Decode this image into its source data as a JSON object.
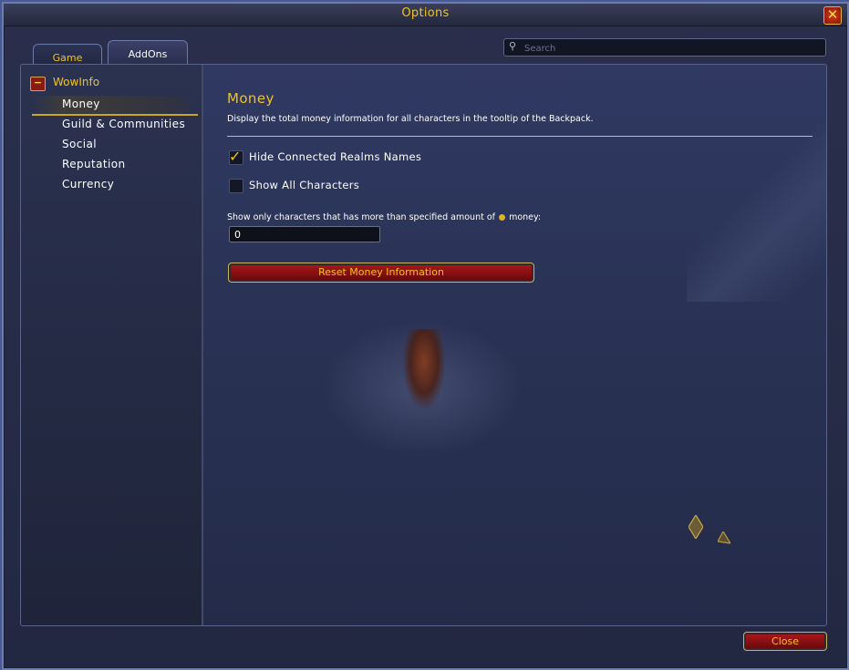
{
  "window": {
    "title": "Options",
    "close_glyph": "✕"
  },
  "tabs": [
    {
      "label": "Game"
    },
    {
      "label": "AddOns"
    }
  ],
  "search": {
    "placeholder": "Search",
    "value": ""
  },
  "sidebar": {
    "addon": {
      "label": "WowInfo",
      "toggle_glyph": "−"
    },
    "items": [
      {
        "label": "Money",
        "selected": true
      },
      {
        "label": "Guild & Communities"
      },
      {
        "label": "Social"
      },
      {
        "label": "Reputation"
      },
      {
        "label": "Currency"
      }
    ]
  },
  "content": {
    "title": "Money",
    "description": "Display the total money information for all characters in the tooltip of the Backpack.",
    "options": [
      {
        "label": "Hide Connected Realms Names",
        "checked": true
      },
      {
        "label": "Show All Characters",
        "checked": false
      }
    ],
    "threshold": {
      "label_pre": "Show only characters that has more than specified amount of",
      "label_post": "money:",
      "value": "0"
    },
    "reset_button": "Reset Money Information"
  },
  "footer": {
    "close_button": "Close"
  },
  "colors": {
    "gold": "#f1c419",
    "panel": "#2a3356",
    "button_red": "#a8161a"
  }
}
